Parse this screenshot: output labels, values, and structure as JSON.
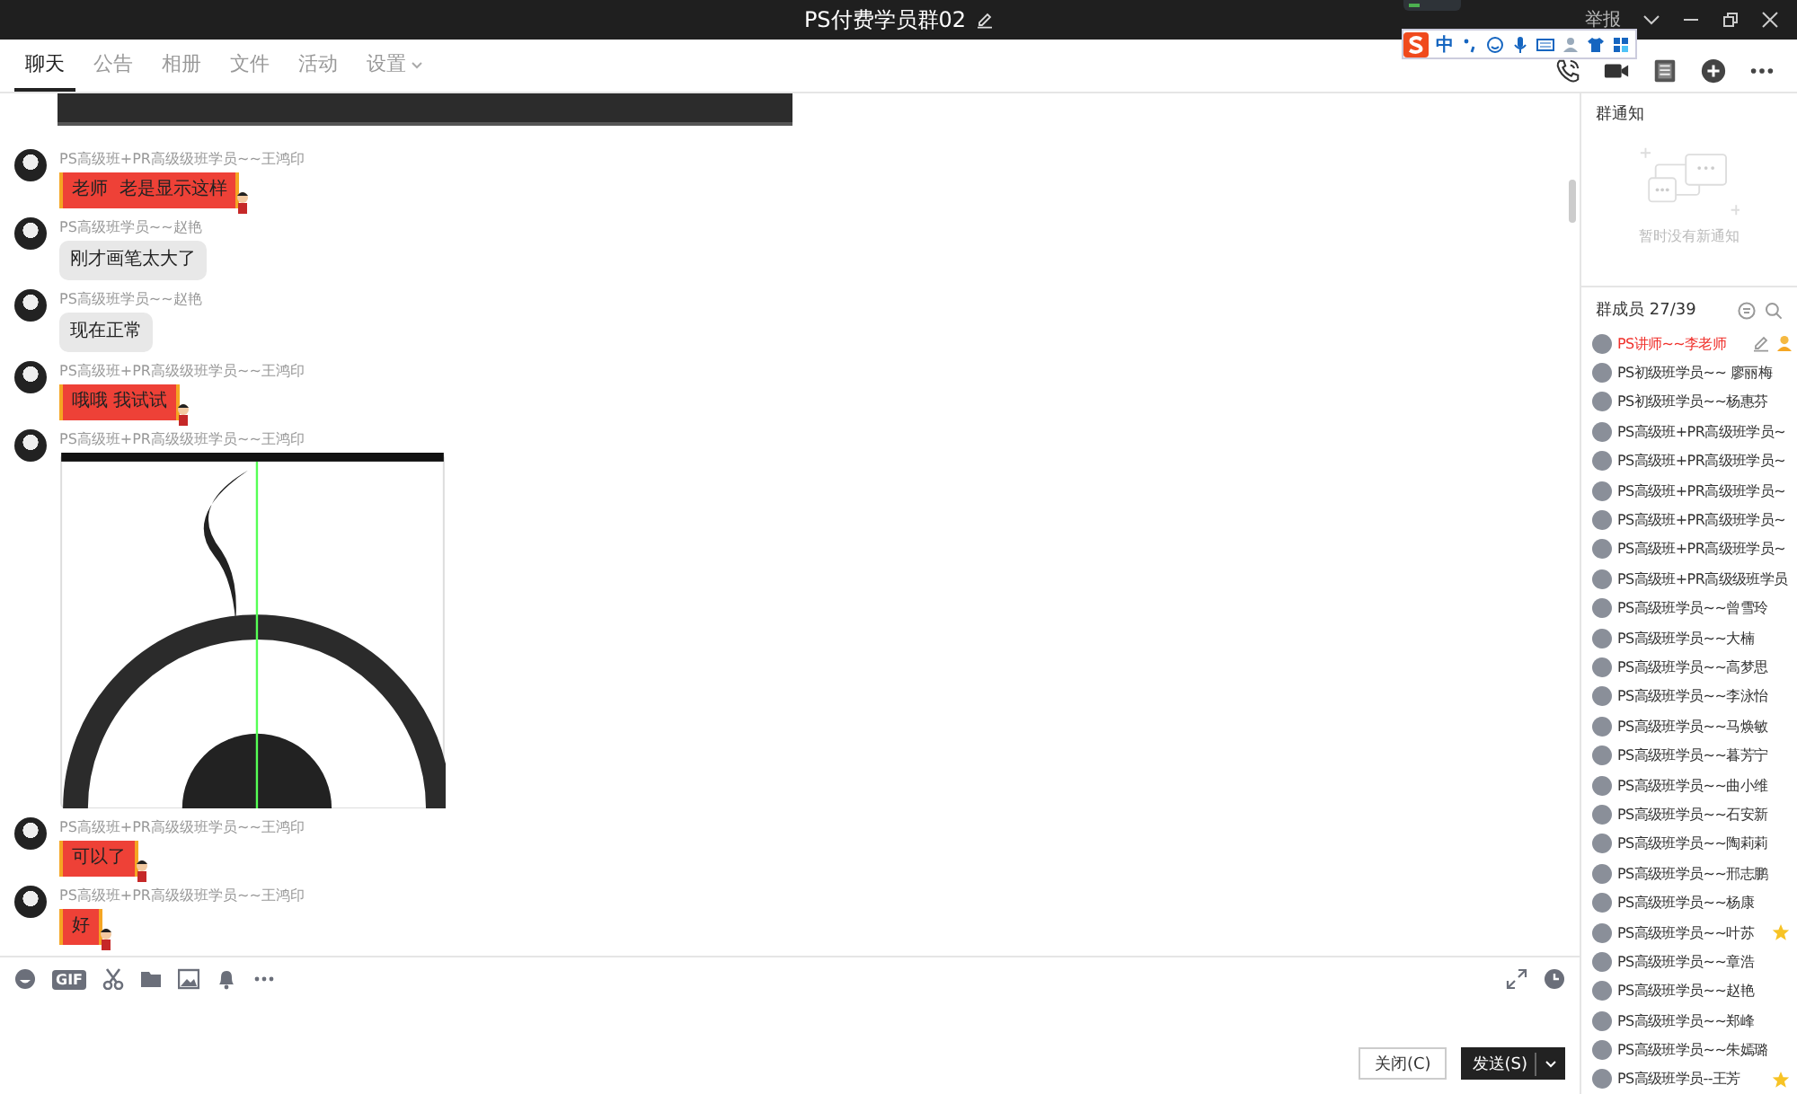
{
  "window": {
    "title": "PS付费学员群02",
    "report": "举报"
  },
  "ime_toolbar": {
    "mode": "中"
  },
  "tabs": [
    {
      "label": "聊天",
      "selected": true,
      "has_menu": false
    },
    {
      "label": "公告",
      "selected": false,
      "has_menu": false
    },
    {
      "label": "相册",
      "selected": false,
      "has_menu": false
    },
    {
      "label": "文件",
      "selected": false,
      "has_menu": false
    },
    {
      "label": "活动",
      "selected": false,
      "has_menu": false
    },
    {
      "label": "设置",
      "selected": false,
      "has_menu": true
    }
  ],
  "messages": [
    {
      "sender": "PS高级班+PR高级级班学员~~王鸿印",
      "kind": "bubble-red",
      "text": "老师  老是显示这样"
    },
    {
      "sender": "PS高级班学员~~赵艳",
      "kind": "bubble-grey",
      "text": "刚才画笔太大了"
    },
    {
      "sender": "PS高级班学员~~赵艳",
      "kind": "bubble-grey",
      "text": "现在正常"
    },
    {
      "sender": "PS高级班+PR高级级班学员~~王鸿印",
      "kind": "bubble-red",
      "text": "哦哦 我试试"
    },
    {
      "sender": "PS高级班+PR高级级班学员~~王鸿印",
      "kind": "image"
    },
    {
      "sender": "PS高级班+PR高级级班学员~~王鸿印",
      "kind": "bubble-red",
      "text": "可以了"
    },
    {
      "sender": "PS高级班+PR高级级班学员~~王鸿印",
      "kind": "bubble-red",
      "text": "好"
    }
  ],
  "notice": {
    "title": "群通知",
    "empty_text": "暂时没有新通知"
  },
  "members": {
    "title": "群成员 27/39",
    "items": [
      {
        "name": "PS讲师~~李老师",
        "admin": true,
        "starred": false
      },
      {
        "name": "PS初级班学员~~ 廖丽梅",
        "admin": false,
        "starred": false
      },
      {
        "name": "PS初级班学员~~杨惠芬",
        "admin": false,
        "starred": false
      },
      {
        "name": "PS高级班+PR高级班学员~",
        "admin": false,
        "starred": false
      },
      {
        "name": "PS高级班+PR高级班学员~",
        "admin": false,
        "starred": false
      },
      {
        "name": "PS高级班+PR高级班学员~",
        "admin": false,
        "starred": false
      },
      {
        "name": "PS高级班+PR高级班学员~",
        "admin": false,
        "starred": false
      },
      {
        "name": "PS高级班+PR高级班学员~",
        "admin": false,
        "starred": false
      },
      {
        "name": "PS高级班+PR高级级班学员",
        "admin": false,
        "starred": false
      },
      {
        "name": "PS高级班学员~~曾雪玲",
        "admin": false,
        "starred": false
      },
      {
        "name": "PS高级班学员~~大楠",
        "admin": false,
        "starred": false
      },
      {
        "name": "PS高级班学员~~高梦思",
        "admin": false,
        "starred": false
      },
      {
        "name": "PS高级班学员~~李泳怡",
        "admin": false,
        "starred": false
      },
      {
        "name": "PS高级班学员~~马焕敏",
        "admin": false,
        "starred": false
      },
      {
        "name": "PS高级班学员~~暮芳宁",
        "admin": false,
        "starred": false
      },
      {
        "name": "PS高级班学员~~曲小维",
        "admin": false,
        "starred": false
      },
      {
        "name": "PS高级班学员~~石安新",
        "admin": false,
        "starred": false
      },
      {
        "name": "PS高级班学员~~陶莉莉",
        "admin": false,
        "starred": false
      },
      {
        "name": "PS高级班学员~~邢志鹏",
        "admin": false,
        "starred": false
      },
      {
        "name": "PS高级班学员~~杨康",
        "admin": false,
        "starred": false
      },
      {
        "name": "PS高级班学员~~叶苏",
        "admin": false,
        "starred": true
      },
      {
        "name": "PS高级班学员~~章浩",
        "admin": false,
        "starred": false
      },
      {
        "name": "PS高级班学员~~赵艳",
        "admin": false,
        "starred": false
      },
      {
        "name": "PS高级班学员~~郑峰",
        "admin": false,
        "starred": false
      },
      {
        "name": "PS高级班学员~~朱嫣璐",
        "admin": false,
        "starred": false
      },
      {
        "name": "PS高级班学员--王芳",
        "admin": false,
        "starred": true
      }
    ]
  },
  "composer": {
    "gif_label": "GIF",
    "close_button": "关闭(C)",
    "send_button": "发送(S)"
  }
}
